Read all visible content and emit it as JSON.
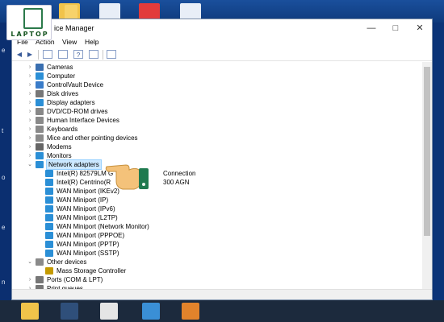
{
  "window": {
    "title": "Device Manager",
    "title_visible": "ice Manager"
  },
  "menu": [
    "File",
    "Action",
    "View",
    "Help"
  ],
  "logo": {
    "text": "LAPTOP"
  },
  "edge_chars": [
    "e",
    "t",
    "o",
    "e",
    "n"
  ],
  "tree": [
    {
      "label": "Cameras",
      "level": 1,
      "expanded": false,
      "icon": "camera-icon",
      "color": "#3a6fb0"
    },
    {
      "label": "Computer",
      "level": 1,
      "expanded": false,
      "icon": "monitor-icon",
      "color": "#2b8fd6"
    },
    {
      "label": "ControlVault Device",
      "level": 1,
      "expanded": false,
      "icon": "device-icon",
      "color": "#3a7cc9"
    },
    {
      "label": "Disk drives",
      "level": 1,
      "expanded": false,
      "icon": "disk-icon",
      "color": "#777777"
    },
    {
      "label": "Display adapters",
      "level": 1,
      "expanded": false,
      "icon": "display-icon",
      "color": "#2b8fd6"
    },
    {
      "label": "DVD/CD-ROM drives",
      "level": 1,
      "expanded": false,
      "icon": "dvd-icon",
      "color": "#888888"
    },
    {
      "label": "Human Interface Devices",
      "level": 1,
      "expanded": false,
      "icon": "hid-icon",
      "color": "#8a8a8a"
    },
    {
      "label": "Keyboards",
      "level": 1,
      "expanded": false,
      "icon": "keyboard-icon",
      "color": "#8a8a8a"
    },
    {
      "label": "Mice and other pointing devices",
      "level": 1,
      "expanded": false,
      "icon": "mouse-icon",
      "color": "#8a8a8a"
    },
    {
      "label": "Modems",
      "level": 1,
      "expanded": false,
      "icon": "modem-icon",
      "color": "#666666"
    },
    {
      "label": "Monitors",
      "level": 1,
      "expanded": false,
      "icon": "monitor-icon",
      "color": "#2b8fd6"
    },
    {
      "label": "Network adapters",
      "level": 1,
      "expanded": true,
      "selected": true,
      "icon": "network-icon",
      "color": "#2b8fd6"
    },
    {
      "label": "Intel(R) 82579LM G",
      "suffix": "Connection",
      "level": 2,
      "icon": "network-card-icon",
      "color": "#2b8fd6"
    },
    {
      "label": "Intel(R) Centrino(R",
      "suffix": "300 AGN",
      "level": 2,
      "icon": "network-card-icon",
      "color": "#2b8fd6"
    },
    {
      "label": "WAN Miniport (IKEv2)",
      "level": 2,
      "icon": "network-card-icon",
      "color": "#2b8fd6"
    },
    {
      "label": "WAN Miniport (IP)",
      "level": 2,
      "icon": "network-card-icon",
      "color": "#2b8fd6"
    },
    {
      "label": "WAN Miniport (IPv6)",
      "level": 2,
      "icon": "network-card-icon",
      "color": "#2b8fd6"
    },
    {
      "label": "WAN Miniport (L2TP)",
      "level": 2,
      "icon": "network-card-icon",
      "color": "#2b8fd6"
    },
    {
      "label": "WAN Miniport (Network Monitor)",
      "level": 2,
      "icon": "network-card-icon",
      "color": "#2b8fd6"
    },
    {
      "label": "WAN Miniport (PPPOE)",
      "level": 2,
      "icon": "network-card-icon",
      "color": "#2b8fd6"
    },
    {
      "label": "WAN Miniport (PPTP)",
      "level": 2,
      "icon": "network-card-icon",
      "color": "#2b8fd6"
    },
    {
      "label": "WAN Miniport (SSTP)",
      "level": 2,
      "icon": "network-card-icon",
      "color": "#2b8fd6"
    },
    {
      "label": "Other devices",
      "level": 1,
      "expanded": true,
      "icon": "other-devices-icon",
      "color": "#8a8a8a"
    },
    {
      "label": "Mass Storage Controller",
      "level": 2,
      "icon": "warning-device-icon",
      "color": "#c49a00"
    },
    {
      "label": "Ports (COM & LPT)",
      "level": 1,
      "expanded": false,
      "icon": "port-icon",
      "color": "#777777"
    },
    {
      "label": "Print queues",
      "level": 1,
      "expanded": false,
      "icon": "printer-icon",
      "color": "#777777"
    }
  ],
  "colors": {
    "selection": "#cce8ff",
    "taskbar": "#1c2a3d",
    "desktop": "#0f4aa3"
  },
  "taskbar_icons": [
    "folder-icon",
    "media-icon",
    "game-icon",
    "network-computer-icon",
    "app-icon"
  ],
  "desktop_icons": [
    "folder-icon",
    "folder-icon",
    "window-icon",
    "app-icon",
    "window-icon"
  ]
}
